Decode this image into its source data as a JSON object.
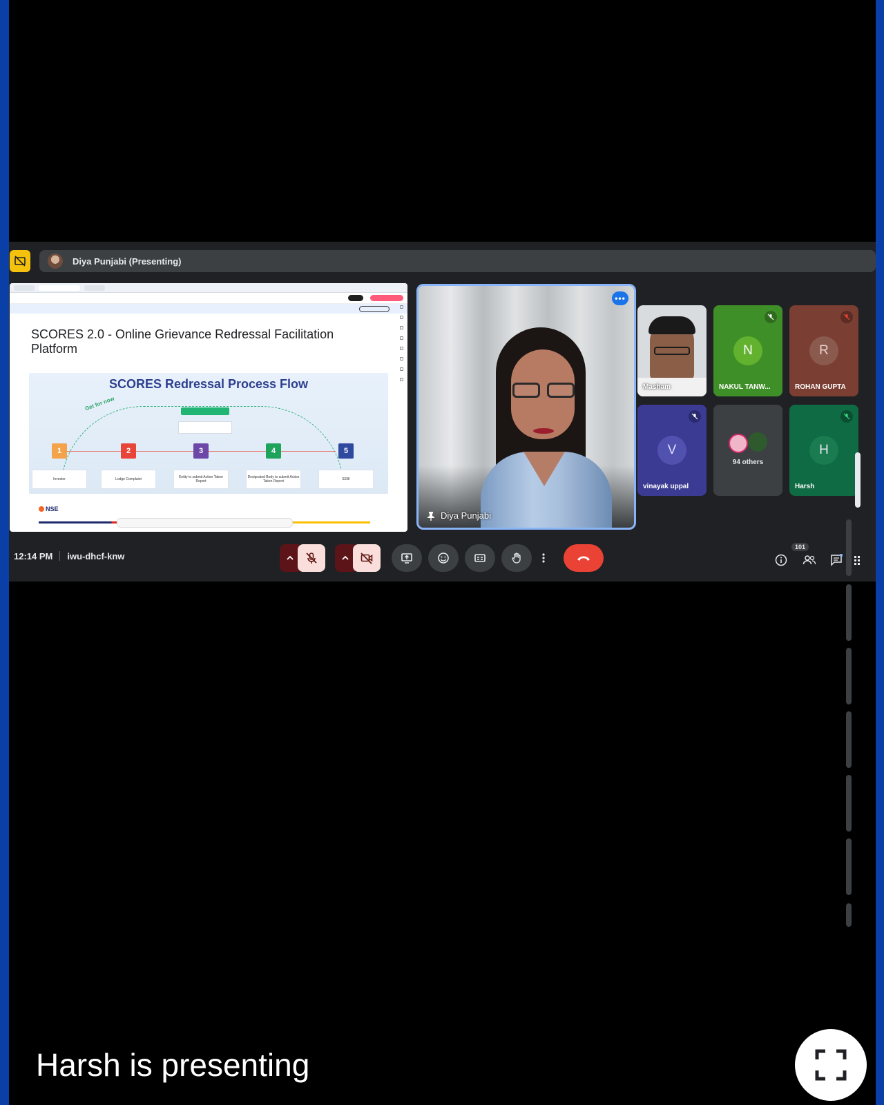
{
  "presenting_bar": {
    "presenter_label": "Diya Punjabi (Presenting)"
  },
  "shared_screen": {
    "slide_title": "SCORES 2.0 - Online Grievance Redressal Facilitation Platform",
    "diagram_title": "SCORES Redressal Process Flow",
    "arc_label": "Get for now",
    "steps": [
      {
        "num": "1",
        "label": "Investor",
        "color": "#f5a34b"
      },
      {
        "num": "2",
        "label": "Lodge Complaint",
        "color": "#e8443a"
      },
      {
        "num": "3",
        "label": "Entity to submit Action Taken Report",
        "color": "#6c47a8"
      },
      {
        "num": "4",
        "label": "Designated Body to submit Action Taken Report",
        "color": "#1ea35b"
      },
      {
        "num": "5",
        "label": "SEBI",
        "color": "#2e4a9e"
      }
    ],
    "logo_text": "NSE"
  },
  "main_speaker": {
    "name": "Diya Punjabi",
    "more_label": "•••"
  },
  "participants": [
    {
      "name": "Masham",
      "initial": "",
      "bg": "#d9dcdf",
      "muted": false
    },
    {
      "name": "NAKUL TANW...",
      "initial": "N",
      "bg": "#3f8f28",
      "avatar_bg": "#62b22f",
      "muted": true
    },
    {
      "name": "ROHAN GUPTA",
      "initial": "R",
      "bg": "#7a3e32",
      "avatar_bg": "#8b5a4f",
      "muted": true
    },
    {
      "name": "vinayak uppal",
      "initial": "V",
      "bg": "#3b3b93",
      "avatar_bg": "#5151b0",
      "muted": true
    },
    {
      "name": "94 others",
      "initial": "",
      "bg": "#3c4043",
      "muted": false
    },
    {
      "name": "Harsh",
      "initial": "H",
      "bg": "#0f6b43",
      "avatar_bg": "#1a7a50",
      "muted": true
    }
  ],
  "controls": {
    "time": "12:14 PM",
    "meeting_code": "iwu-dhcf-knw",
    "people_count": "101"
  },
  "overlay": {
    "presenting_text": "Harsh is presenting"
  },
  "colors": {
    "accent": "#8ab4f8",
    "end_call": "#ea4335",
    "present_toggle": "#f4c20d"
  }
}
